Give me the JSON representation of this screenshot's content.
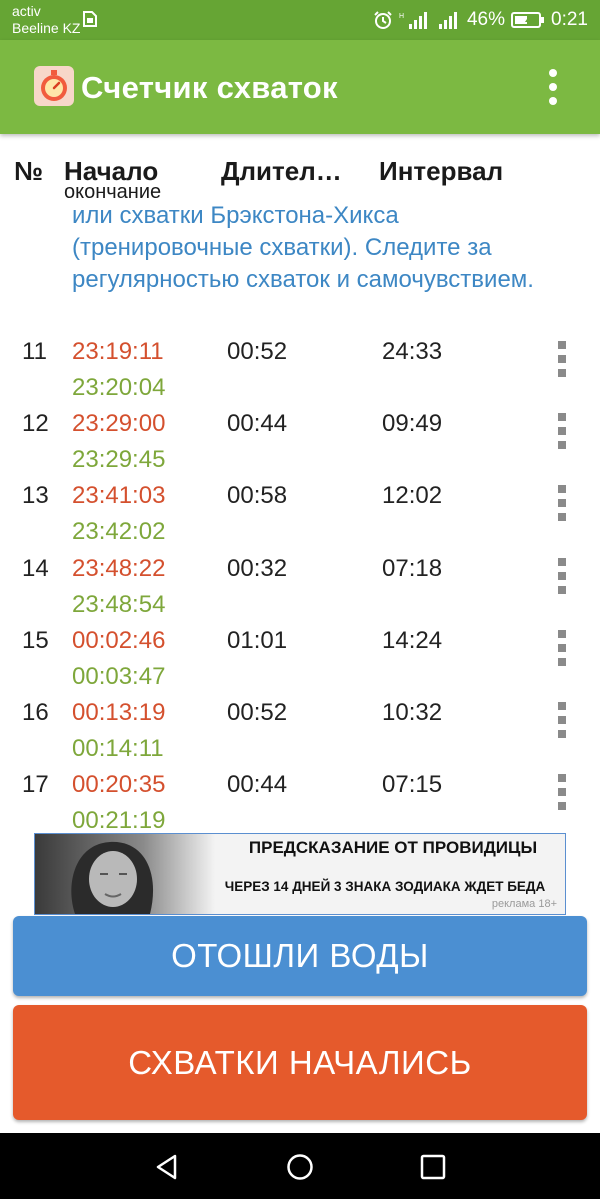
{
  "status_bar": {
    "carrier_line1": "activ",
    "carrier_line2": "Beeline KZ",
    "battery": "46%",
    "time": "0:21",
    "icons": [
      "sim-icon",
      "alarm-icon",
      "signal-icon",
      "signal-icon",
      "battery-icon"
    ]
  },
  "app_bar": {
    "title": "Счетчик схваток",
    "logo_icon": "stopwatch-icon",
    "menu_icon": "more-vert-icon"
  },
  "table": {
    "headers": {
      "number": "№",
      "start": "Начало",
      "start_sub": "окончание",
      "duration": "Длител…",
      "interval": "Интервал"
    },
    "info_text": "или схватки Брэкстона-Хикса (тренировочные схватки). Следите за регулярностью схваток и самочувствием.",
    "rows": [
      {
        "num": "11",
        "start": "23:19:11",
        "end": "23:20:04",
        "duration": "00:52",
        "interval": "24:33"
      },
      {
        "num": "12",
        "start": "23:29:00",
        "end": "23:29:45",
        "duration": "00:44",
        "interval": "09:49"
      },
      {
        "num": "13",
        "start": "23:41:03",
        "end": "23:42:02",
        "duration": "00:58",
        "interval": "12:02"
      },
      {
        "num": "14",
        "start": "23:48:22",
        "end": "23:48:54",
        "duration": "00:32",
        "interval": "07:18"
      },
      {
        "num": "15",
        "start": "00:02:46",
        "end": "00:03:47",
        "duration": "01:01",
        "interval": "14:24"
      },
      {
        "num": "16",
        "start": "00:13:19",
        "end": "00:14:11",
        "duration": "00:52",
        "interval": "10:32"
      },
      {
        "num": "17",
        "start": "00:20:35",
        "end": "00:21:19",
        "duration": "00:44",
        "interval": "07:15"
      }
    ]
  },
  "ad": {
    "title": "ПРЕДСКАЗАНИЕ ОТ ПРОВИДИЦЫ",
    "subtitle": "ЧЕРЕЗ 14 ДНЕЙ 3 ЗНАКА ЗОДИАКА ЖДЕТ БЕДА",
    "mark": "реклама 18+"
  },
  "buttons": {
    "water": "ОТОШЛИ ВОДЫ",
    "contractions": "СХВАТКИ НАЧАЛИСЬ"
  },
  "nav_bar": {
    "icons": [
      "back-icon",
      "home-icon",
      "recents-icon"
    ]
  },
  "colors": {
    "status_bar": "#66a534",
    "app_bar": "#7cb942",
    "start_time": "#d4502e",
    "end_time": "#7ea73b",
    "info_text": "#3d87c4",
    "water_button": "#4b8fd2",
    "start_button": "#e55a2c"
  }
}
